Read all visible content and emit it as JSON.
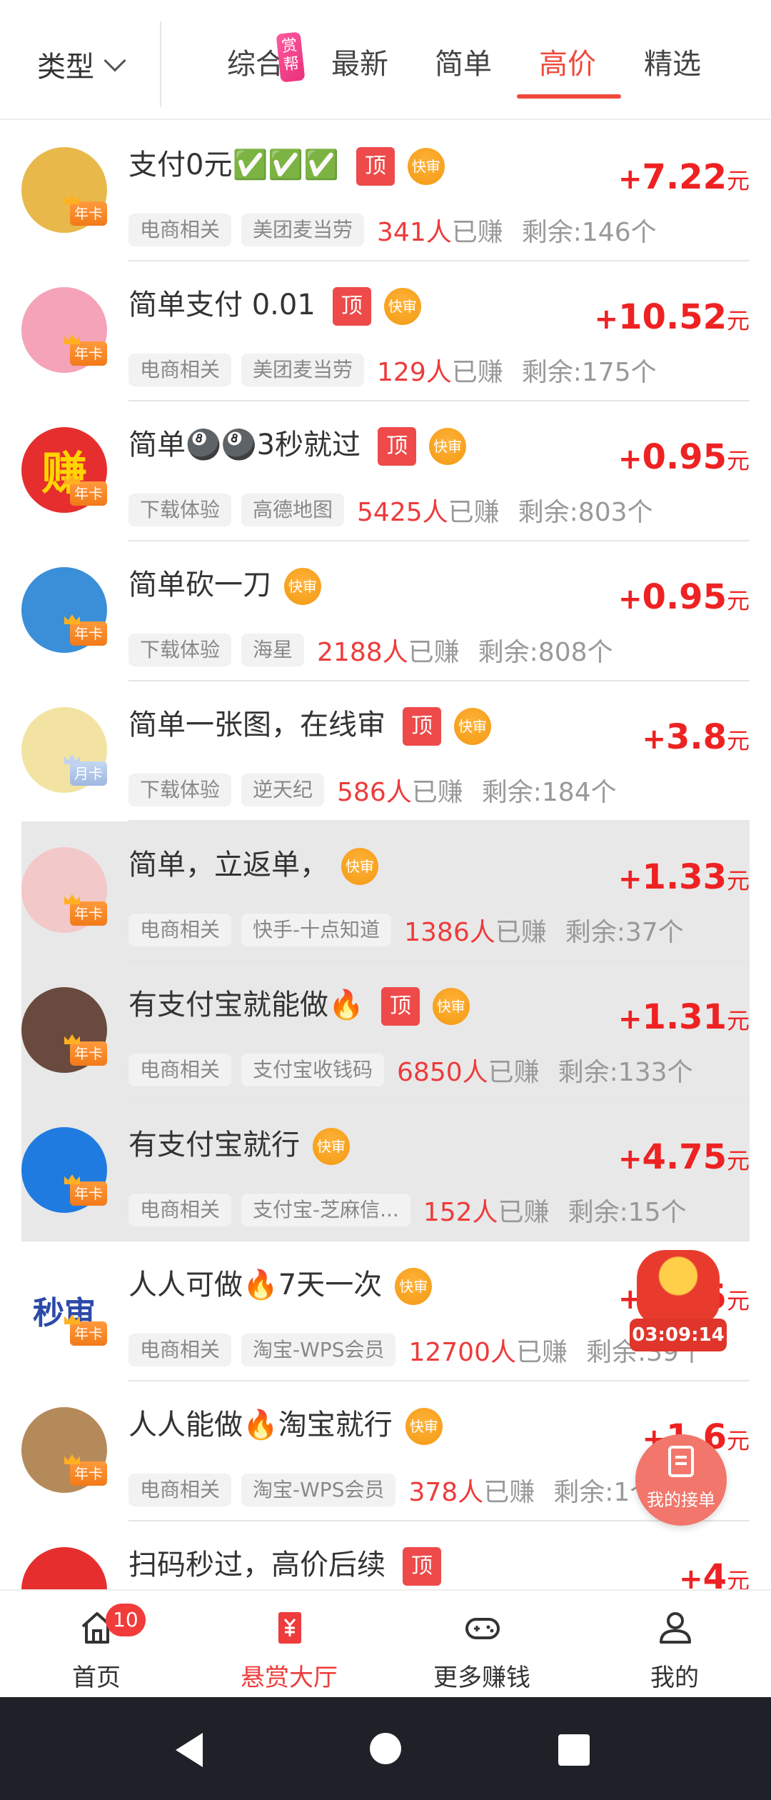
{
  "header": {
    "filter_label": "类型",
    "tabs": [
      {
        "label": "综合",
        "badge": "赏帮"
      },
      {
        "label": "最新"
      },
      {
        "label": "简单"
      },
      {
        "label": "高价"
      },
      {
        "label": "精选"
      }
    ],
    "active_tab": "高价"
  },
  "tags": {
    "top": "顶",
    "fast": "快审"
  },
  "earned_suffix": "已赚",
  "tasks": [
    {
      "title": "支付0元✅✅✅",
      "top": true,
      "fast": true,
      "category": "电商相关",
      "app": "美团麦当劳",
      "earned": "341人",
      "remaining": "剩余:146个",
      "reward": "7.22",
      "vip": "年卡",
      "avatar_color": "#e8b84a"
    },
    {
      "title": "简单支付 0.01",
      "top": true,
      "fast": true,
      "category": "电商相关",
      "app": "美团麦当劳",
      "earned": "129人",
      "remaining": "剩余:175个",
      "reward": "10.52",
      "vip": "年卡",
      "avatar_color": "#f4a3b8"
    },
    {
      "title": "简单🎱🎱3秒就过",
      "top": true,
      "fast": true,
      "category": "下载体验",
      "app": "高德地图",
      "earned": "5425人",
      "remaining": "剩余:803个",
      "reward": "0.95",
      "vip": "年卡",
      "avatar_color": "#e62e2e",
      "avatar_text": "赚"
    },
    {
      "title": "简单砍一刀",
      "top": false,
      "fast": true,
      "category": "下载体验",
      "app": "海星",
      "earned": "2188人",
      "remaining": "剩余:808个",
      "reward": "0.95",
      "vip": "年卡",
      "avatar_color": "#3a8fd8"
    },
    {
      "title": "简单一张图，在线审",
      "top": true,
      "fast": true,
      "category": "下载体验",
      "app": "逆天纪",
      "earned": "586人",
      "remaining": "剩余:184个",
      "reward": "3.8",
      "vip": "月卡",
      "avatar_color": "#f2e3a2"
    },
    {
      "title": "简单，立返单，",
      "top": false,
      "fast": true,
      "category": "电商相关",
      "app": "快手-十点知道",
      "earned": "1386人",
      "remaining": "剩余:37个",
      "reward": "1.33",
      "vip": "年卡",
      "avatar_color": "#f3c8c8",
      "highlight": true
    },
    {
      "title": "有支付宝就能做🔥",
      "top": true,
      "fast": true,
      "category": "电商相关",
      "app": "支付宝收钱码",
      "earned": "6850人",
      "remaining": "剩余:133个",
      "reward": "1.31",
      "vip": "年卡",
      "avatar_color": "#6a4a3e",
      "highlight": true
    },
    {
      "title": "有支付宝就行",
      "top": false,
      "fast": true,
      "category": "电商相关",
      "app": "支付宝-芝麻信...",
      "earned": "152人",
      "remaining": "剩余:15个",
      "reward": "4.75",
      "vip": "年卡",
      "avatar_color": "#1f7be0",
      "highlight": true
    },
    {
      "title": "人人可做🔥7天一次",
      "top": false,
      "fast": true,
      "category": "电商相关",
      "app": "淘宝-WPS会员",
      "earned": "12700人",
      "remaining": "剩余:39个",
      "reward": "1.75",
      "vip": "年卡",
      "avatar_color": "#ffffff",
      "avatar_text": "秒审"
    },
    {
      "title": "人人能做🔥淘宝就行",
      "top": false,
      "fast": true,
      "category": "电商相关",
      "app": "淘宝-WPS会员",
      "earned": "378人",
      "remaining": "剩余:1个",
      "reward": "1.6",
      "vip": "年卡",
      "avatar_color": "#b58a5a"
    },
    {
      "title": "扫码秒过，高价后续",
      "top": true,
      "fast": false,
      "category": "",
      "app": "",
      "earned": "",
      "remaining": "",
      "reward": "4",
      "vip": "",
      "avatar_color": "#e62e2e"
    }
  ],
  "currency_unit": "元",
  "floating": {
    "timer": "03:09:14",
    "my_orders": "我的接单"
  },
  "bottom_nav": [
    {
      "label": "首页",
      "badge": "10"
    },
    {
      "label": "悬赏大厅"
    },
    {
      "label": "更多赚钱"
    },
    {
      "label": "我的"
    }
  ]
}
